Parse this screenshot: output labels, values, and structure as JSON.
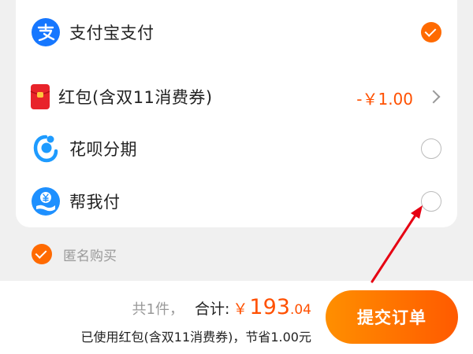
{
  "payment_methods": [
    {
      "label": "支付宝支付",
      "icon": "alipay-icon",
      "state": "selected"
    },
    {
      "label": "红包(含双11消费券)",
      "icon": "red-packet-icon",
      "amount": "-￥1.00"
    },
    {
      "label": "花呗分期",
      "icon": "huabei-icon",
      "state": "unselected"
    },
    {
      "label": "帮我付",
      "icon": "pay-for-me-icon",
      "state": "unselected"
    }
  ],
  "anonymous": {
    "label": "匿名购买",
    "checked": true
  },
  "bottom": {
    "count": "共1件，",
    "total_label": "合计:",
    "currency": "￥",
    "total_integer": "193",
    "total_decimal": ".04",
    "saving_text": "已使用红包(含双11消费券)，节省1.00元",
    "submit_label": "提交订单"
  },
  "colors": {
    "accent": "#ff6a00",
    "price": "#ff5000",
    "alipay_blue": "#1677ff",
    "annotation_arrow": "#e60012"
  }
}
